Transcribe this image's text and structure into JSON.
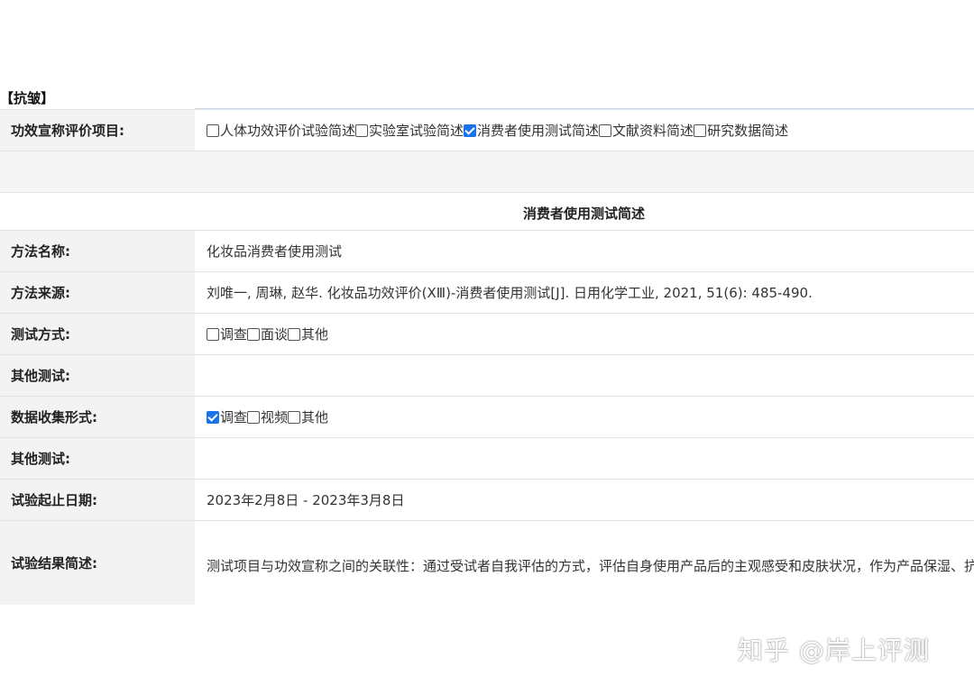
{
  "section_title": "【抗皱】",
  "claim_eval": {
    "label": "功效宣称评价项目:",
    "options": [
      {
        "label": "人体功效评价试验简述",
        "checked": false
      },
      {
        "label": "实验室试验简述",
        "checked": false
      },
      {
        "label": "消费者使用测试简述",
        "checked": true
      },
      {
        "label": "文献资料简述",
        "checked": false
      },
      {
        "label": "研究数据简述",
        "checked": false
      }
    ]
  },
  "sub_header": "消费者使用测试简述",
  "method_name": {
    "label": "方法名称:",
    "value": "化妆品消费者使用测试"
  },
  "method_source": {
    "label": "方法来源:",
    "value": "刘唯一, 周琳, 赵华. 化妆品功效评价(ⅩⅢ)-消费者使用测试[J]. 日用化学工业, 2021, 51(6): 485-490."
  },
  "test_mode": {
    "label": "测试方式:",
    "options": [
      {
        "label": "调查",
        "checked": false
      },
      {
        "label": "面谈",
        "checked": false
      },
      {
        "label": "其他",
        "checked": false
      }
    ]
  },
  "other_test_1": {
    "label": "其他测试:",
    "value": ""
  },
  "data_collection": {
    "label": "数据收集形式:",
    "options": [
      {
        "label": "调查",
        "checked": true
      },
      {
        "label": "视频",
        "checked": false
      },
      {
        "label": "其他",
        "checked": false
      }
    ]
  },
  "other_test_2": {
    "label": "其他测试:",
    "value": ""
  },
  "test_dates": {
    "label": "试验起止日期:",
    "value": "2023年2月8日 - 2023年3月8日"
  },
  "result_summary": {
    "label": "试验结果简述:",
    "value": "测试项目与功效宣称之间的关联性：通过受试者自我评估的方式，评估自身使用产品后的主观感受和皮肤状况，作为产品保湿、抗皱、宣称温和（无刺激）的功效测试依据。测试人数：测试人数入组33名，测试有效人数33名。测试人员肤质类型：03 普通人群，健康中国女性肌肤。测试方法判定为有效的依据：计数资料（问卷），采用所有有益项（3分+4分+5分）的累计百分比作为满意率，结果作二项式检验。显著性差异水平为p<0.05。试验结果表明，测试产品自然堂凝时鲜颜肌活冰肌水 清润型具有保湿、抗皱、宣称温和（无刺激）功效。"
  },
  "watermark": "知乎 @岸上评测"
}
